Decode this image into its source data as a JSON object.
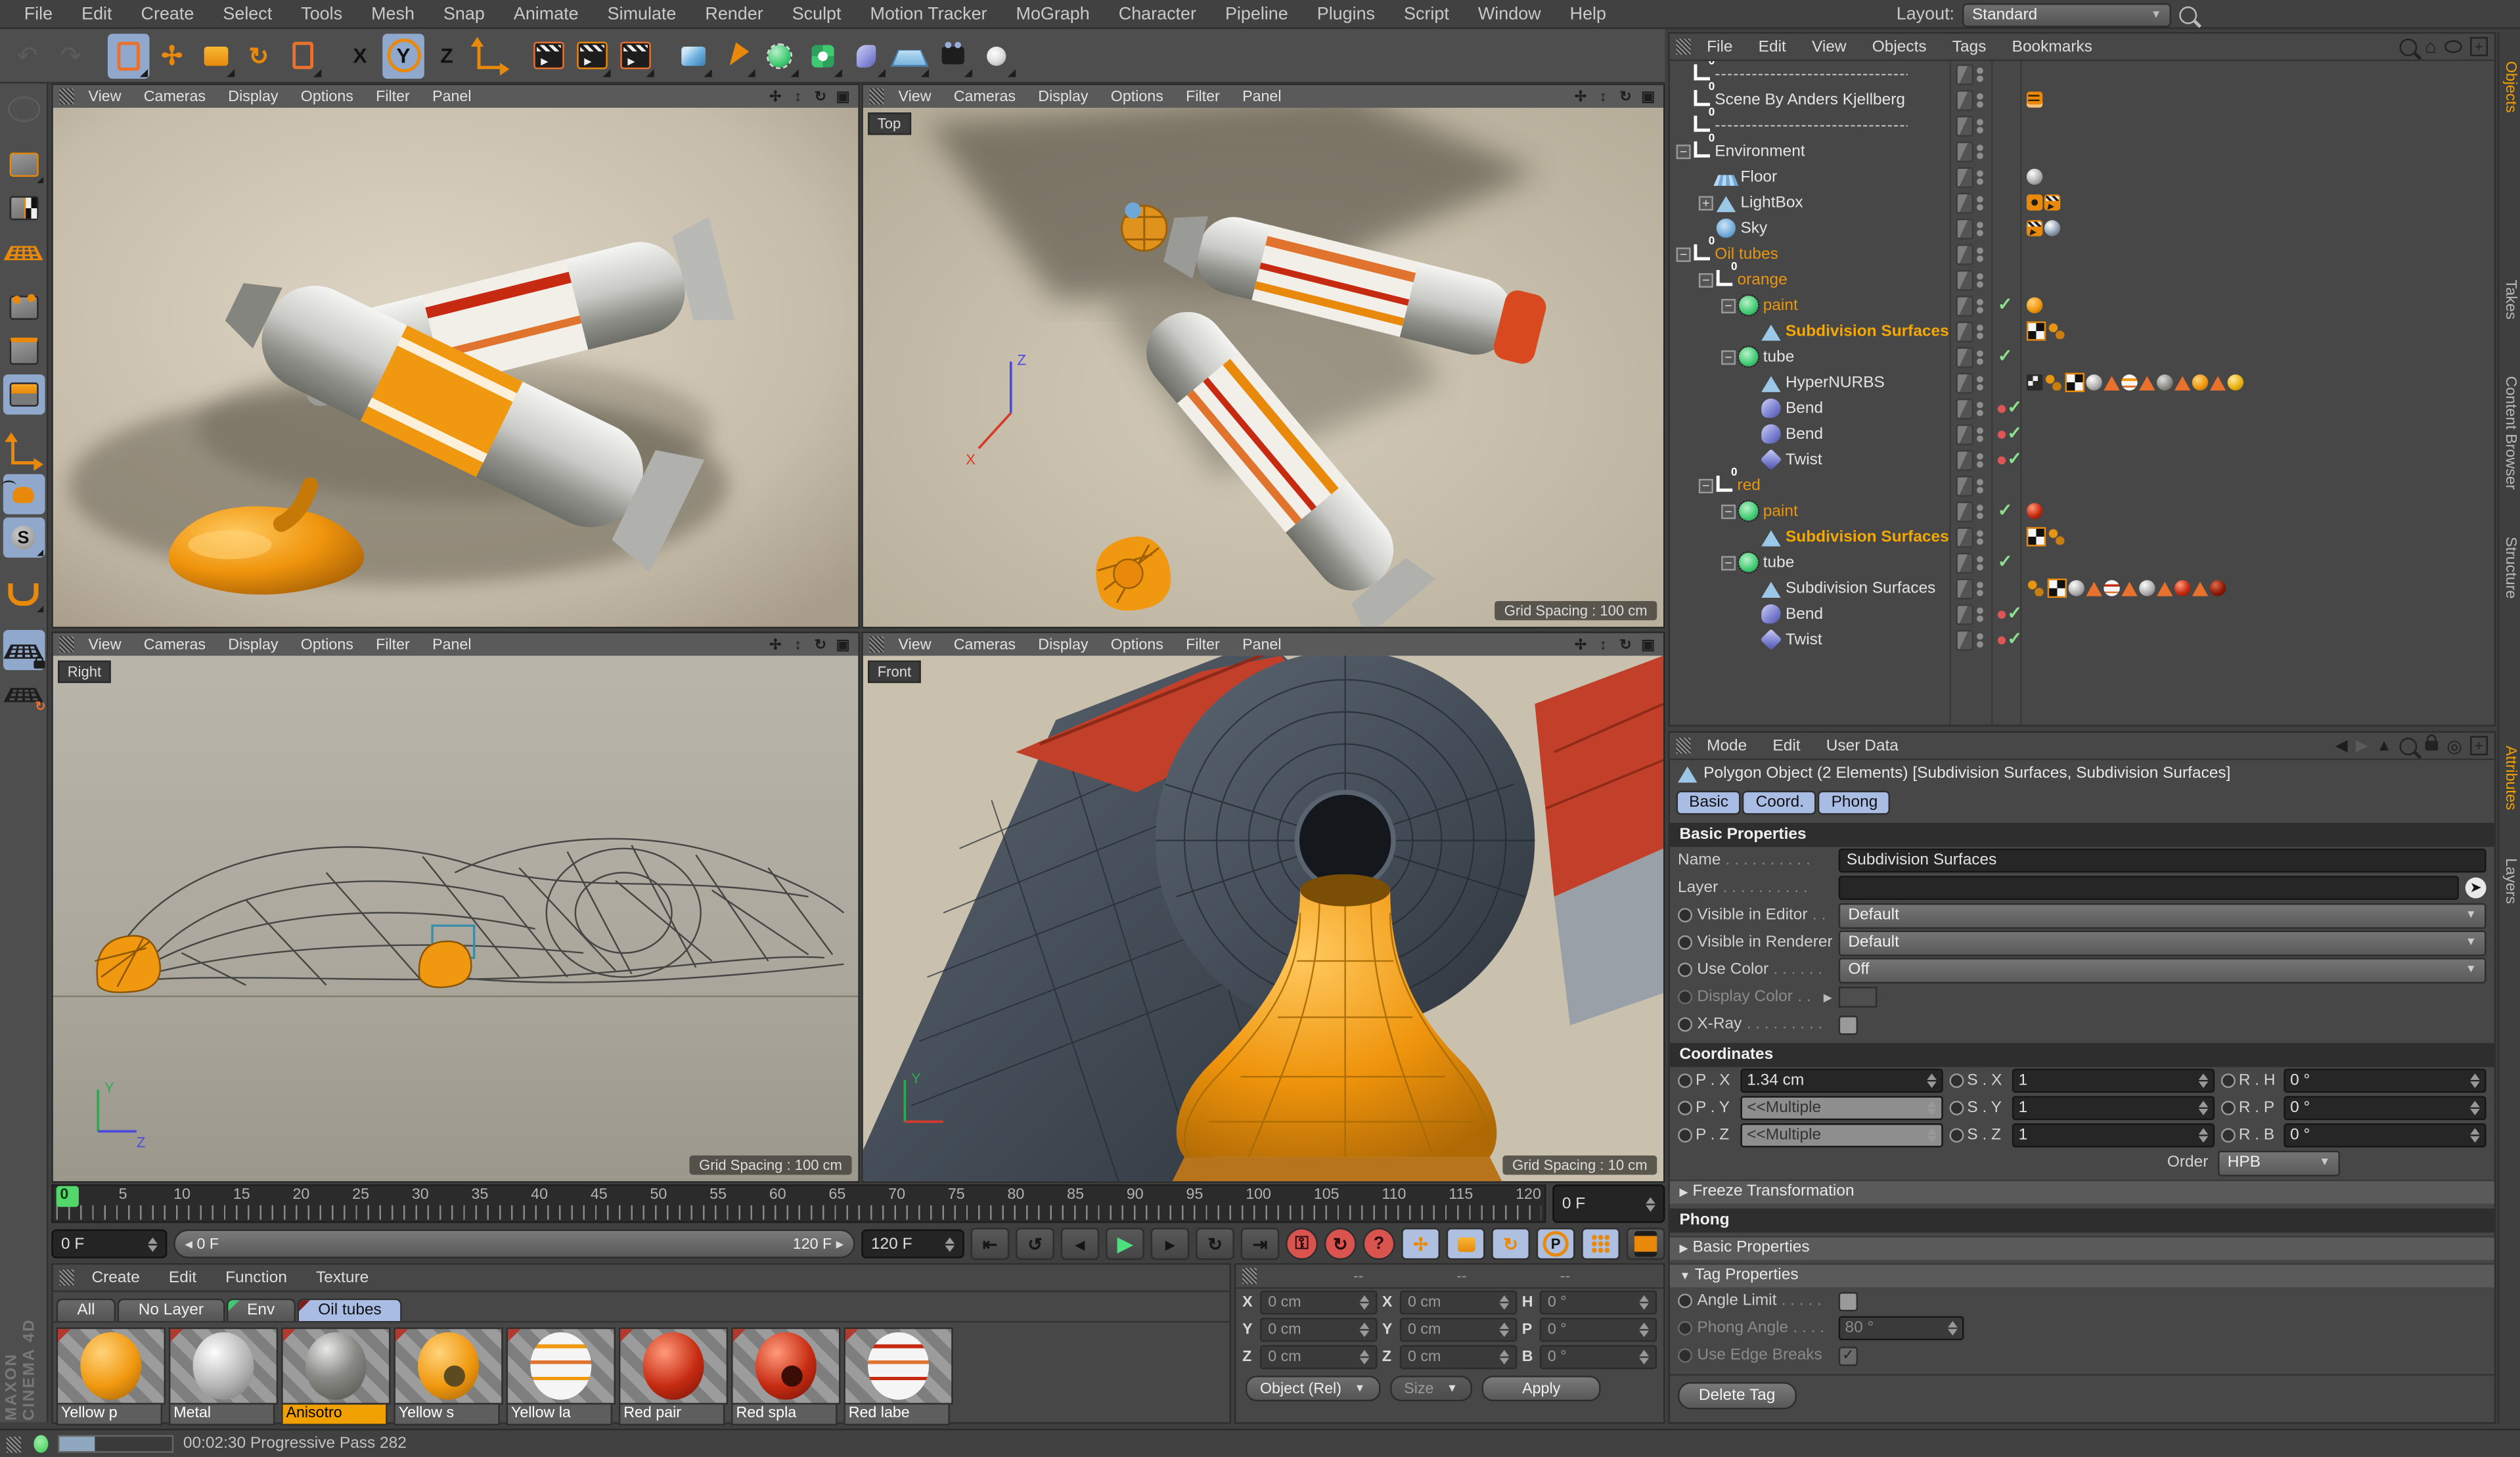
{
  "app": {
    "layout_label": "Layout:",
    "layout_value": "Standard"
  },
  "menubar": [
    "File",
    "Edit",
    "Create",
    "Select",
    "Tools",
    "Mesh",
    "Snap",
    "Animate",
    "Simulate",
    "Render",
    "Sculpt",
    "Motion Tracker",
    "MoGraph",
    "Character",
    "Pipeline",
    "Plugins",
    "Script",
    "Window",
    "Help"
  ],
  "viewports": {
    "menu": [
      "View",
      "Cameras",
      "Display",
      "Options",
      "Filter",
      "Panel"
    ],
    "top": {
      "label": "Top",
      "grid": "Grid Spacing : 100 cm"
    },
    "right": {
      "label": "Right",
      "grid": "Grid Spacing : 100 cm"
    },
    "front": {
      "label": "Front",
      "grid": "Grid Spacing : 10 cm"
    }
  },
  "object_manager": {
    "menu": [
      "File",
      "Edit",
      "View",
      "Objects",
      "Tags",
      "Bookmarks"
    ],
    "rows": [
      {
        "label": "--------------------------------",
        "tags": [],
        "state": []
      },
      {
        "label": "Scene By Anders Kjellberg",
        "tags": [
          "note"
        ],
        "state": []
      },
      {
        "label": "--------------------------------",
        "tags": [],
        "state": []
      },
      {
        "label": "Environment",
        "tags": [],
        "state": []
      },
      {
        "label": "Floor",
        "tags": [
          "sphere-silver"
        ],
        "state": []
      },
      {
        "label": "LightBox",
        "tags": [
          "eye",
          "clapper"
        ],
        "state": []
      },
      {
        "label": "Sky",
        "tags": [
          "clapper",
          "sphere-chrome"
        ],
        "state": []
      },
      {
        "label": "Oil tubes",
        "tags": [],
        "state": []
      },
      {
        "label": "orange",
        "tags": [],
        "state": []
      },
      {
        "label": "paint",
        "tags": [
          "sphere-orange"
        ],
        "state": [
          "check"
        ]
      },
      {
        "label": "Subdivision Surfaces",
        "tags": [
          "checker",
          "dots"
        ],
        "state": []
      },
      {
        "label": "tube",
        "tags": [],
        "state": [
          "check"
        ]
      },
      {
        "label": "HyperNURBS",
        "tags": [
          "flag",
          "dots",
          "checker",
          "sphere-silver",
          "tri",
          "sphere-label-o",
          "tri",
          "sphere-gray",
          "tri",
          "sphere-orange",
          "tri",
          "sphere-gold"
        ],
        "state": []
      },
      {
        "label": "Bend",
        "tags": [],
        "state": [
          "reddot",
          "check"
        ]
      },
      {
        "label": "Bend",
        "tags": [],
        "state": [
          "reddot",
          "check"
        ]
      },
      {
        "label": "Twist",
        "tags": [],
        "state": [
          "reddot",
          "check"
        ]
      },
      {
        "label": "red",
        "tags": [],
        "state": []
      },
      {
        "label": "paint",
        "tags": [
          "sphere-red"
        ],
        "state": [
          "check"
        ]
      },
      {
        "label": "Subdivision Surfaces",
        "tags": [
          "checker",
          "dots"
        ],
        "state": []
      },
      {
        "label": "tube",
        "tags": [],
        "state": [
          "check"
        ]
      },
      {
        "label": "Subdivision Surfaces",
        "tags": [
          "dots",
          "checker",
          "sphere-silver",
          "tri",
          "sphere-label-r",
          "tri",
          "sphere-silver2",
          "tri",
          "sphere-red",
          "tri",
          "sphere-darkred"
        ],
        "state": []
      },
      {
        "label": "Bend",
        "tags": [],
        "state": [
          "reddot",
          "check"
        ]
      },
      {
        "label": "Twist",
        "tags": [],
        "state": [
          "reddot",
          "check"
        ]
      }
    ],
    "side_tabs": [
      "Objects",
      "Takes",
      "Content Browser",
      "Structure"
    ]
  },
  "attributes": {
    "menu": [
      "Mode",
      "Edit",
      "User Data"
    ],
    "side_tabs": [
      "Attributes",
      "Layers"
    ],
    "title": "Polygon Object (2 Elements) [Subdivision Surfaces, Subdivision Surfaces]",
    "tabs": [
      "Basic",
      "Coord.",
      "Phong"
    ],
    "basic_header": "Basic Properties",
    "fields": {
      "name_label": "Name",
      "name_value": "Subdivision Surfaces",
      "layer_label": "Layer",
      "visible_editor_label": "Visible in Editor",
      "visible_editor_value": "Default",
      "visible_renderer_label": "Visible in Renderer",
      "visible_renderer_value": "Default",
      "use_color_label": "Use Color",
      "use_color_value": "Off",
      "display_color_label": "Display Color",
      "xray_label": "X-Ray"
    },
    "coordinates_header": "Coordinates",
    "coords": {
      "px_label": "P . X",
      "px": "1.34 cm",
      "sx_label": "S . X",
      "sx": "1",
      "rh_label": "R . H",
      "rh": "0 °",
      "py_label": "P . Y",
      "py": "<<Multiple",
      "sy_label": "S . Y",
      "sy": "1",
      "rp_label": "R . P",
      "rp": "0 °",
      "pz_label": "P . Z",
      "pz": "<<Multiple",
      "sz_label": "S . Z",
      "sz": "1",
      "rb_label": "R . B",
      "rb": "0 °",
      "order_label": "Order",
      "order": "HPB"
    },
    "freeze_label": "Freeze Transformation",
    "phong_header": "Phong",
    "phong": {
      "basic_props": "Basic Properties",
      "tag_props": "Tag Properties",
      "angle_limit": "Angle Limit",
      "phong_angle_label": "Phong Angle",
      "phong_angle_value": "80 °",
      "edge_breaks": "Use Edge Breaks",
      "delete_tag": "Delete Tag"
    }
  },
  "timeline": {
    "labels": [
      "0",
      "5",
      "10",
      "15",
      "20",
      "25",
      "30",
      "35",
      "40",
      "45",
      "50",
      "55",
      "60",
      "65",
      "70",
      "75",
      "80",
      "85",
      "90",
      "95",
      "100",
      "105",
      "110",
      "115",
      "120"
    ],
    "current_field": "0 F",
    "range_start": "0 F",
    "range_end": "120 F",
    "end_field": "120 F"
  },
  "materials": {
    "menu": [
      "Create",
      "Edit",
      "Function",
      "Texture"
    ],
    "tabs": [
      "All",
      "No Layer",
      "Env",
      "Oil tubes"
    ],
    "items": [
      {
        "name": "Yellow p"
      },
      {
        "name": "Metal"
      },
      {
        "name": "Anisotro"
      },
      {
        "name": "Yellow s"
      },
      {
        "name": "Yellow la"
      },
      {
        "name": "Red pair"
      },
      {
        "name": "Red spla"
      },
      {
        "name": "Red labe"
      }
    ]
  },
  "coord_panel": {
    "headers": [
      "--",
      "--",
      "--"
    ],
    "pos": {
      "x_label": "X",
      "x": "0 cm",
      "y_label": "Y",
      "y": "0 cm",
      "z_label": "Z",
      "z": "0 cm"
    },
    "size": {
      "x_label": "X",
      "x": "0 cm",
      "y_label": "Y",
      "y": "0 cm",
      "z_label": "Z",
      "z": "0 cm"
    },
    "rot": {
      "h_label": "H",
      "h": "0 °",
      "p_label": "P",
      "p": "0 °",
      "b_label": "B",
      "b": "0 °"
    },
    "mode": "Object (Rel)",
    "size_mode": "Size",
    "apply": "Apply"
  },
  "statusbar": {
    "text": "00:02:30 Progressive Pass 282"
  },
  "branding": {
    "text": "MAXON CINEMA 4D"
  },
  "colors": {
    "accent_orange": "#e8890b",
    "selection_blue": "#8fa8cc",
    "highlight_text": "#f5a800",
    "play_green": "#53d76a",
    "record_red": "#d9534f"
  }
}
